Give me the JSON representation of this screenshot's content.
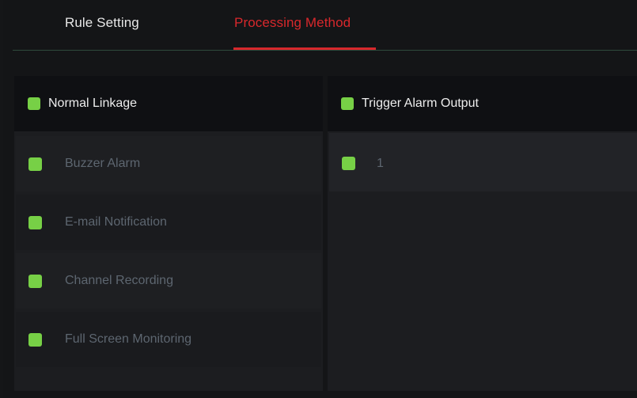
{
  "tabs": [
    {
      "label": "Rule Setting",
      "active": false
    },
    {
      "label": "Processing Method",
      "active": true
    }
  ],
  "colors": {
    "active_tab": "#d8282c",
    "checkbox": "#77d046",
    "header_text": "#ededed",
    "disabled_text": "#5d6670"
  },
  "normal_linkage": {
    "label": "Normal Linkage",
    "checked": true,
    "items": [
      {
        "label": "Buzzer Alarm",
        "checked": true
      },
      {
        "label": "E-mail Notification",
        "checked": true
      },
      {
        "label": "Channel Recording",
        "checked": true
      },
      {
        "label": "Full Screen Monitoring",
        "checked": true
      }
    ]
  },
  "trigger_alarm_output": {
    "label": "Trigger Alarm Output",
    "checked": true,
    "items": [
      {
        "label": "1",
        "checked": true
      }
    ]
  }
}
